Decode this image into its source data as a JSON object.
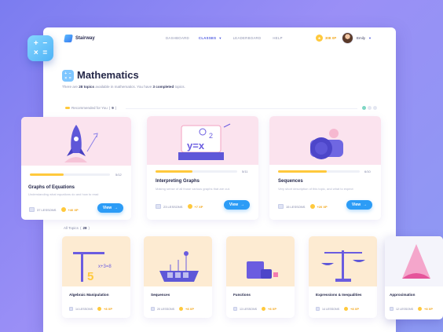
{
  "app": {
    "name": "Stairway"
  },
  "nav": [
    {
      "label": "DASHBOARD",
      "active": false
    },
    {
      "label": "CLASSES",
      "active": true
    },
    {
      "label": "LEADERBOARD",
      "active": false
    },
    {
      "label": "HELP",
      "active": false
    }
  ],
  "user": {
    "xp": "308 XP",
    "name": "Emily"
  },
  "page": {
    "title": "Mathematics",
    "summary_prefix": "There are",
    "topics_count": "28 topics",
    "summary_mid": "available in mathematics. You have",
    "completed": "3 completed",
    "summary_suffix": "topics."
  },
  "recommended": {
    "label": "Recommended for You",
    "count": "9",
    "cards": [
      {
        "title": "Graphs of Equations",
        "description": "Understanding what equations do and how to read",
        "progress_text": "5/12",
        "progress": 0.42,
        "lessons": "37 LESSONS",
        "xp": "+40 XP",
        "button": "View"
      },
      {
        "title": "Interpreting Graphs",
        "description": "Making sense of all those various graphs that are out.",
        "progress_text": "5/11",
        "progress": 0.45,
        "lessons": "23 LESSONS",
        "xp": "+7 XP",
        "button": "View"
      },
      {
        "title": "Sequences",
        "description": "Very short description of this topic, and what to expect",
        "progress_text": "6/10",
        "progress": 0.6,
        "lessons": "15 LESSONS",
        "xp": "+20 XP",
        "button": "View"
      }
    ]
  },
  "all_topics": {
    "label": "All Topics",
    "count": "28",
    "items": [
      {
        "title": "Algebraic Manipulation",
        "lessons": "14 LESSONS",
        "xp": "+8 XP"
      },
      {
        "title": "Sequences",
        "lessons": "20 LESSONS",
        "xp": "+8 XP"
      },
      {
        "title": "Functions",
        "lessons": "13 LESSONS",
        "xp": "+8 XP"
      },
      {
        "title": "Expressions & Inequalities",
        "lessons": "14 LESSONS",
        "xp": "+8 XP"
      },
      {
        "title": "Approximation",
        "lessons": "12 LESSONS",
        "xp": "+8 XP"
      }
    ]
  },
  "colors": {
    "accent": "#2c9cf6",
    "xp": "#f2a516",
    "progress": "#ffc93c",
    "title": "#242748"
  }
}
